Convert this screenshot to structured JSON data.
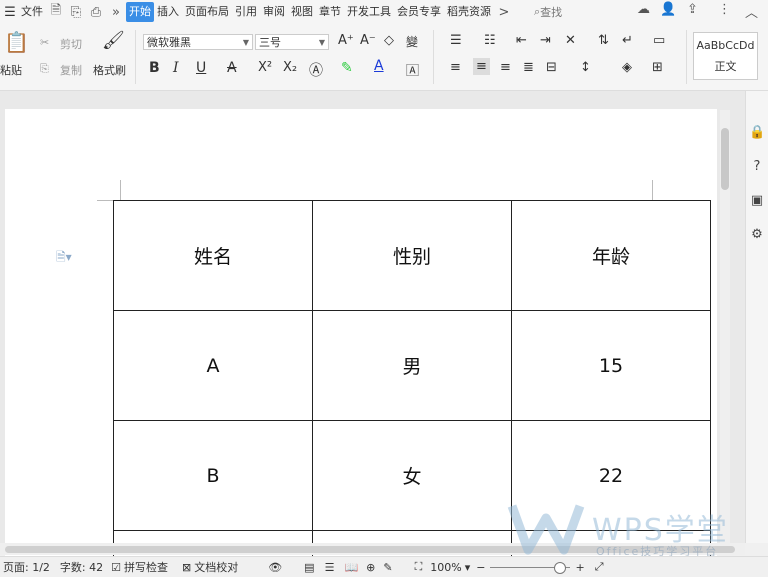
{
  "menu": {
    "file": "文件",
    "tabs": [
      "开始",
      "插入",
      "页面布局",
      "引用",
      "审阅",
      "视图",
      "章节",
      "开发工具",
      "会员专享",
      "稻壳资源"
    ],
    "active_tab": "开始",
    "search": "查找",
    "expand_glyph": "»",
    "more_glyph": ">"
  },
  "ribbon": {
    "paste": "粘贴",
    "cut": "剪切",
    "copy": "复制",
    "format_painter": "格式刷",
    "font_name": "微软雅黑",
    "font_size": "三号",
    "bold": "B",
    "italic": "I",
    "underline": "U",
    "strike": "A",
    "superscript": "X²",
    "subscript": "X₂",
    "style_preview": "AaBbCcDd",
    "style_name": "正文"
  },
  "table": {
    "rows": [
      [
        "姓名",
        "性别",
        "年龄"
      ],
      [
        "A",
        "男",
        "15"
      ],
      [
        "B",
        "女",
        "22"
      ],
      [
        "",
        "",
        ""
      ]
    ]
  },
  "status": {
    "page": "页面: 1/2",
    "word_count": "字数: 42",
    "spell_check": "拼写检查",
    "doc_proof": "文档校对",
    "zoom": "100%"
  },
  "watermark": {
    "brand": "WPS学堂",
    "sub": "Office技巧学习平台"
  },
  "colors": {
    "accent": "#3a8ee6",
    "highlight": "#2ecc40",
    "font_color": "#1a3ad8"
  }
}
